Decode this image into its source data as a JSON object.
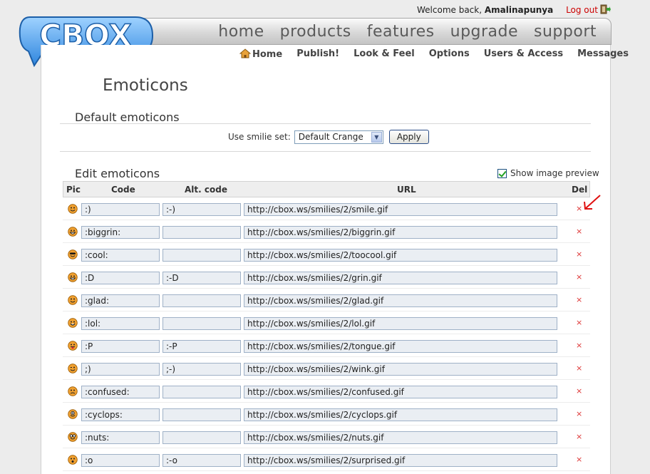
{
  "header": {
    "welcome_prefix": "Welcome back,",
    "username": "Amalinapunya",
    "logout": "Log out"
  },
  "logo": {
    "text": "CBOX"
  },
  "nav_main": [
    "home",
    "products",
    "features",
    "upgrade",
    "support"
  ],
  "subnav": [
    "Home",
    "Publish!",
    "Look & Feel",
    "Options",
    "Users & Access",
    "Messages"
  ],
  "page": {
    "title": "Emoticons",
    "default_section": "Default emoticons",
    "smilie_label": "Use smilie set:",
    "smilie_value": "Default Crange",
    "apply": "Apply",
    "edit_section": "Edit emoticons",
    "show_preview": "Show image preview"
  },
  "table": {
    "headers": {
      "pic": "Pic",
      "code": "Code",
      "alt": "Alt. code",
      "url": "URL",
      "del": "Del"
    },
    "del_symbol": "×",
    "rows": [
      {
        "code": ":)",
        "alt": ":-)",
        "url": "http://cbox.ws/smilies/2/smile.gif",
        "face": "smile"
      },
      {
        "code": ":biggrin:",
        "alt": "",
        "url": "http://cbox.ws/smilies/2/biggrin.gif",
        "face": "biggrin"
      },
      {
        "code": ":cool:",
        "alt": "",
        "url": "http://cbox.ws/smilies/2/toocool.gif",
        "face": "cool"
      },
      {
        "code": ":D",
        "alt": ":-D",
        "url": "http://cbox.ws/smilies/2/grin.gif",
        "face": "grin"
      },
      {
        "code": ":glad:",
        "alt": "",
        "url": "http://cbox.ws/smilies/2/glad.gif",
        "face": "glad"
      },
      {
        "code": ":lol:",
        "alt": "",
        "url": "http://cbox.ws/smilies/2/lol.gif",
        "face": "lol"
      },
      {
        "code": ":P",
        "alt": ":-P",
        "url": "http://cbox.ws/smilies/2/tongue.gif",
        "face": "tongue"
      },
      {
        "code": ";)",
        "alt": ";-)",
        "url": "http://cbox.ws/smilies/2/wink.gif",
        "face": "wink"
      },
      {
        "code": ":confused:",
        "alt": "",
        "url": "http://cbox.ws/smilies/2/confused.gif",
        "face": "confused"
      },
      {
        "code": ":cyclops:",
        "alt": "",
        "url": "http://cbox.ws/smilies/2/cyclops.gif",
        "face": "cyclops"
      },
      {
        "code": ":nuts:",
        "alt": "",
        "url": "http://cbox.ws/smilies/2/nuts.gif",
        "face": "nuts"
      },
      {
        "code": ":o",
        "alt": ":-o",
        "url": "http://cbox.ws/smilies/2/surprised.gif",
        "face": "surprised"
      }
    ]
  },
  "colors": {
    "accent_blue": "#3a8ee6",
    "logout_red": "#cc0000",
    "delete_red": "#dd3333"
  }
}
